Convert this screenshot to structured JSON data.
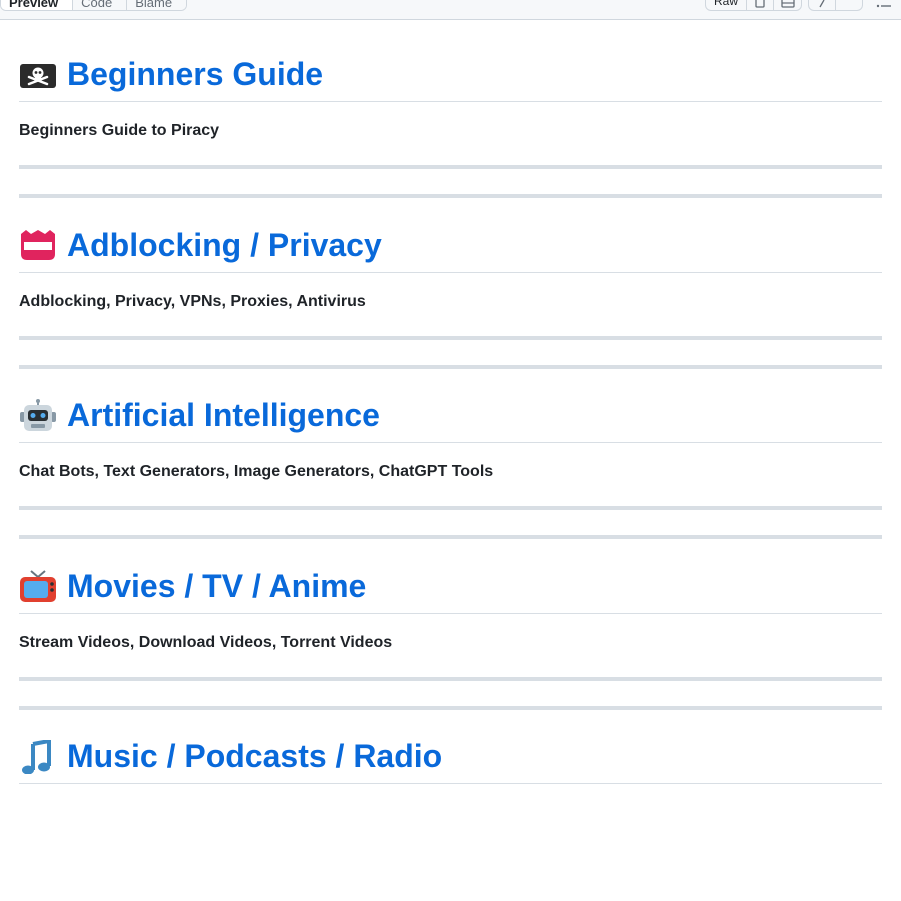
{
  "toolbar": {
    "tabs": [
      {
        "label": "Preview",
        "active": true
      },
      {
        "label": "Code",
        "active": false
      },
      {
        "label": "Blame",
        "active": false
      }
    ],
    "raw_label": "Raw",
    "copy_icon": "copy-icon",
    "download_icon": "download-icon",
    "edit_icon": "pencil-icon",
    "more_icon": "chevron-down-icon",
    "outline_icon": "list-icon"
  },
  "colors": {
    "link_blue": "#0969da",
    "text": "#1f2328",
    "rule": "#d8dee4",
    "toolbar_bg": "#f6f8fa"
  },
  "sections": [
    {
      "emoji": "pirate-flag-icon",
      "title": "Beginners Guide",
      "description": "Beginners Guide to Piracy"
    },
    {
      "emoji": "name-badge-icon",
      "title": "Adblocking / Privacy",
      "description": "Adblocking, Privacy, VPNs, Proxies, Antivirus"
    },
    {
      "emoji": "robot-icon",
      "title": "Artificial Intelligence",
      "description": "Chat Bots, Text Generators, Image Generators, ChatGPT Tools"
    },
    {
      "emoji": "television-icon",
      "title": "Movies / TV / Anime",
      "description": "Stream Videos, Download Videos, Torrent Videos"
    },
    {
      "emoji": "music-note-icon",
      "title": "Music / Podcasts / Radio",
      "description": ""
    }
  ]
}
